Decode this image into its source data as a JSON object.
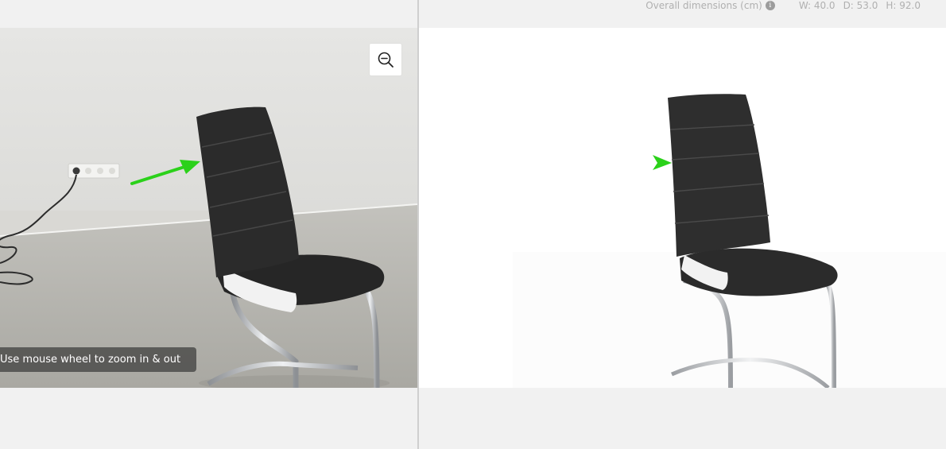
{
  "left": {
    "header_text": "",
    "zoom_hint": "Use mouse wheel to zoom in & out",
    "zoom_icon": "zoom-out-icon"
  },
  "right": {
    "dimensions_label": "Overall dimensions (cm)",
    "info_icon": "info-icon",
    "width": "W: 40.0",
    "depth": "D: 53.0",
    "height": "H: 92.0"
  },
  "colors": {
    "background": "#f1f1f1",
    "arrow": "#2bd11a",
    "chair_leather": "#2b2b2b",
    "chair_trim": "#f2f2f2",
    "chrome": "#b9bcc0"
  }
}
